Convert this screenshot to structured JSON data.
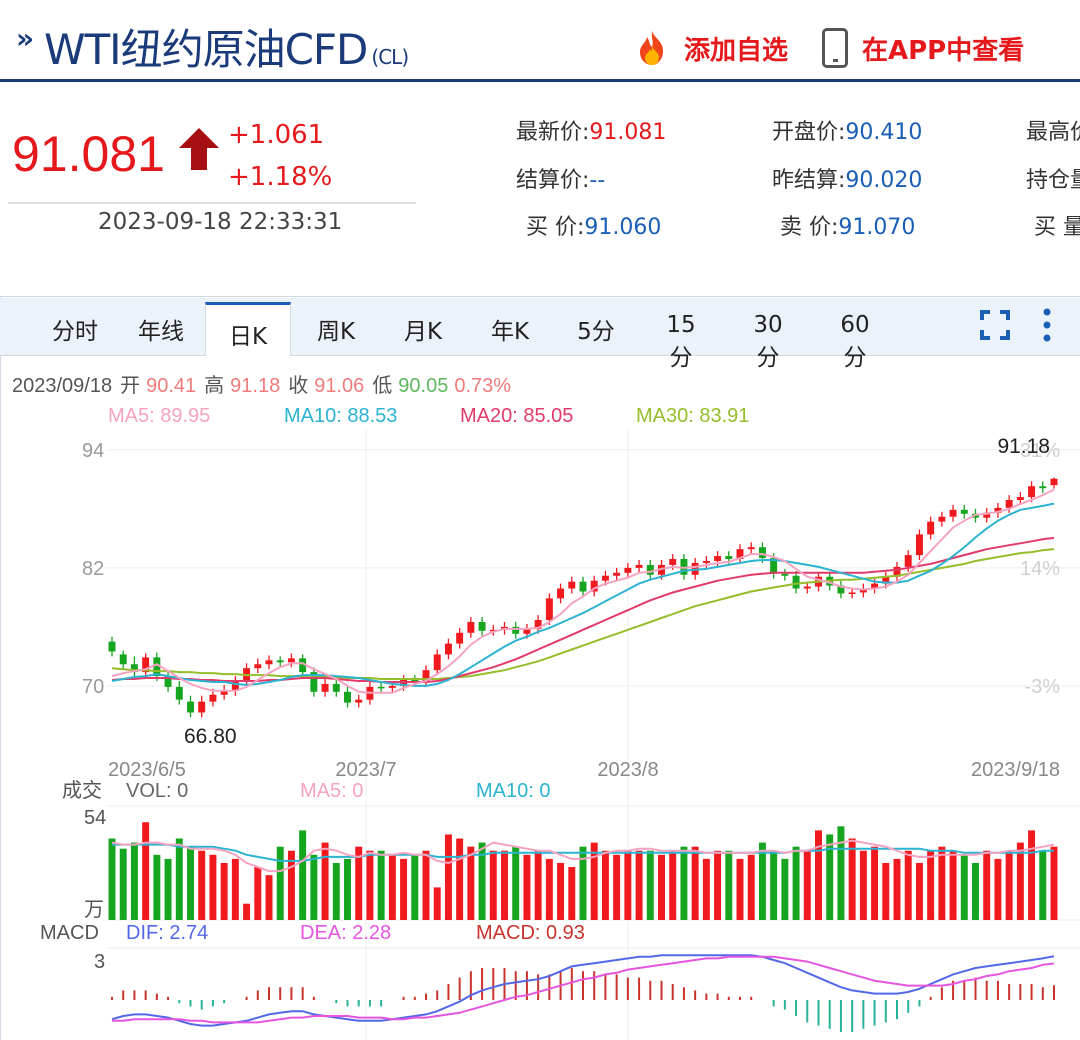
{
  "header": {
    "chevron": "»",
    "title": "WTI纽约原油CFD",
    "title_sub": "(CL)",
    "add_fav_label": "添加自选",
    "app_label": "在APP中查看"
  },
  "price": {
    "last": "91.081",
    "change": "+1.061",
    "change_pct": "+1.18%",
    "time": "2023-09-18 22:33:31"
  },
  "quote": {
    "last_label": "最新价:",
    "last_value": "91.081",
    "open_label": "开盘价:",
    "open_value": "90.410",
    "high_label": "最高价",
    "settle_label": "结算价:",
    "settle_value": "--",
    "prev_settle_label": "昨结算:",
    "prev_settle_value": "90.020",
    "oi_label": "持仓量",
    "bid_label": "买 价:",
    "bid_value": "91.060",
    "ask_label": "卖 价:",
    "ask_value": "91.070",
    "bid_vol_label": "买 量"
  },
  "tabs": [
    "分时",
    "年线",
    "日K",
    "周K",
    "月K",
    "年K",
    "5分",
    "15分",
    "30分",
    "60分"
  ],
  "active_tab": "日K",
  "colors": {
    "up": "#f0191e",
    "down": "#15a51f",
    "ma5": "#f5a3c0",
    "ma10": "#2bb3d1",
    "ma20": "#e23b6b",
    "ma30": "#94be2a",
    "dif": "#5368e6",
    "dea": "#e555e0",
    "macd_up": "#c9332b",
    "macd_down": "#26b39a"
  },
  "chart_data": {
    "type": "candlestick",
    "info_line": {
      "date": "2023/09/18",
      "open_label": "开",
      "open": "90.41",
      "high_label": "高",
      "high": "91.18",
      "close_label": "收",
      "close": "91.06",
      "low_label": "低",
      "low": "90.05",
      "pct": "0.73%"
    },
    "ma_legend": {
      "ma5": "MA5: 89.95",
      "ma10": "MA10: 88.53",
      "ma20": "MA20: 85.05",
      "ma30": "MA30: 83.91"
    },
    "y_ticks": [
      "94",
      "82",
      "70"
    ],
    "y_ticks_right": [
      "31%",
      "14%",
      "-3%"
    ],
    "ylim": [
      64.5,
      95
    ],
    "x_labels": [
      "2023/6/5",
      "2023/7",
      "2023/8",
      "2023/9/18"
    ],
    "max_label": "91.18",
    "min_label": "66.80",
    "closes": [
      73.5,
      72.2,
      71.4,
      72.9,
      71.0,
      69.9,
      68.6,
      67.3,
      68.4,
      69.1,
      69.5,
      70.5,
      71.8,
      72.2,
      72.6,
      72.4,
      72.8,
      71.4,
      69.4,
      70.2,
      69.4,
      68.3,
      68.6,
      69.9,
      69.8,
      70.0,
      70.6,
      70.5,
      71.6,
      73.2,
      74.3,
      75.4,
      76.5,
      75.6,
      75.7,
      76.0,
      75.3,
      75.8,
      76.7,
      78.9,
      79.9,
      80.6,
      79.6,
      80.7,
      81.2,
      81.5,
      82.0,
      82.3,
      81.3,
      82.3,
      82.9,
      81.3,
      82.5,
      82.7,
      83.2,
      82.9,
      83.9,
      84.1,
      83.0,
      81.4,
      81.2,
      79.9,
      80.1,
      81.1,
      80.2,
      79.4,
      79.5,
      79.9,
      80.4,
      81.1,
      82.1,
      83.3,
      85.4,
      86.7,
      87.2,
      87.9,
      87.5,
      87.1,
      87.6,
      88.1,
      88.9,
      89.2,
      90.3,
      90.1,
      91.06
    ],
    "opens": [
      74.5,
      73.2,
      72.2,
      71.4,
      72.9,
      71.0,
      69.9,
      68.4,
      67.3,
      68.4,
      69.1,
      69.5,
      70.5,
      71.8,
      72.2,
      72.6,
      72.4,
      72.8,
      71.4,
      69.4,
      70.2,
      69.4,
      68.3,
      68.6,
      69.9,
      69.8,
      70.0,
      70.6,
      70.5,
      71.6,
      73.2,
      74.3,
      75.4,
      76.5,
      75.6,
      75.7,
      76.0,
      75.3,
      75.8,
      76.7,
      78.9,
      79.9,
      80.6,
      79.6,
      80.7,
      81.2,
      81.5,
      82.0,
      82.3,
      81.3,
      82.3,
      82.9,
      81.3,
      82.5,
      82.7,
      83.2,
      82.9,
      83.9,
      84.1,
      83.0,
      81.4,
      81.2,
      79.9,
      80.1,
      81.1,
      80.2,
      79.4,
      79.5,
      79.9,
      80.4,
      81.1,
      82.1,
      83.3,
      85.4,
      86.7,
      87.2,
      87.9,
      87.5,
      87.1,
      87.6,
      88.1,
      88.9,
      89.2,
      90.3,
      90.41
    ],
    "highs": [
      75.0,
      73.6,
      73.0,
      73.3,
      73.4,
      71.6,
      70.5,
      69.0,
      69.0,
      69.7,
      70.1,
      71.0,
      72.3,
      72.8,
      73.1,
      73.0,
      73.3,
      73.2,
      71.9,
      70.7,
      70.7,
      69.9,
      69.1,
      70.4,
      70.4,
      70.4,
      71.1,
      71.1,
      72.1,
      73.7,
      74.8,
      75.9,
      77.0,
      77.0,
      76.2,
      76.5,
      76.5,
      76.3,
      77.2,
      79.4,
      80.4,
      81.1,
      81.1,
      81.2,
      81.7,
      82.0,
      82.5,
      82.8,
      82.8,
      82.8,
      83.4,
      83.4,
      83.0,
      83.2,
      83.7,
      83.7,
      84.4,
      84.6,
      84.6,
      83.5,
      81.9,
      81.7,
      80.6,
      81.6,
      81.6,
      80.7,
      80.0,
      80.4,
      80.9,
      81.6,
      82.6,
      83.8,
      85.9,
      87.2,
      87.7,
      88.4,
      88.4,
      88.0,
      88.1,
      88.6,
      89.4,
      89.7,
      90.8,
      90.8,
      91.18
    ],
    "lows": [
      73.0,
      71.7,
      70.9,
      70.9,
      70.5,
      69.4,
      68.1,
      66.8,
      66.8,
      67.9,
      68.6,
      69.0,
      70.0,
      71.3,
      71.7,
      71.9,
      71.9,
      70.9,
      68.9,
      68.9,
      68.9,
      67.8,
      67.8,
      68.1,
      69.3,
      69.3,
      69.5,
      70.0,
      70.0,
      71.1,
      72.7,
      73.8,
      74.9,
      75.1,
      75.1,
      75.2,
      74.8,
      74.8,
      75.3,
      76.2,
      78.4,
      79.4,
      79.1,
      79.1,
      80.2,
      80.7,
      81.0,
      81.5,
      80.8,
      80.8,
      81.8,
      80.8,
      80.8,
      82.0,
      82.2,
      82.4,
      82.4,
      83.4,
      82.5,
      80.9,
      80.7,
      79.4,
      79.4,
      79.6,
      79.7,
      78.9,
      78.9,
      79.0,
      79.4,
      79.9,
      80.6,
      81.6,
      82.8,
      84.9,
      86.2,
      86.7,
      87.0,
      86.6,
      86.6,
      87.1,
      87.6,
      88.4,
      88.7,
      89.6,
      90.05
    ],
    "ma5": [
      71.0,
      71.3,
      71.5,
      71.7,
      72.2,
      71.5,
      70.8,
      70.2,
      69.8,
      69.5,
      69.5,
      69.5,
      69.9,
      70.6,
      71.3,
      71.9,
      72.3,
      72.3,
      71.7,
      71.2,
      70.7,
      70.0,
      69.4,
      69.3,
      69.3,
      69.3,
      69.8,
      70.2,
      70.5,
      71.2,
      72.0,
      73.0,
      74.2,
      75.0,
      75.5,
      75.8,
      75.8,
      75.8,
      75.9,
      76.5,
      77.3,
      78.4,
      79.1,
      79.9,
      80.4,
      80.7,
      81.0,
      81.5,
      81.6,
      81.9,
      82.1,
      82.0,
      82.1,
      82.3,
      82.5,
      82.6,
      83.0,
      83.4,
      83.4,
      83.1,
      82.7,
      81.9,
      81.1,
      80.8,
      80.5,
      80.1,
      79.9,
      79.8,
      79.9,
      80.1,
      80.6,
      81.3,
      82.5,
      83.7,
      84.9,
      86.1,
      86.8,
      87.4,
      87.5,
      87.7,
      88.0,
      88.5,
      88.9,
      89.4,
      89.95
    ],
    "ma10": [
      70.5,
      70.7,
      70.9,
      71.0,
      71.2,
      71.0,
      70.8,
      70.6,
      70.5,
      70.4,
      70.4,
      70.2,
      70.1,
      70.2,
      70.4,
      70.6,
      70.9,
      71.1,
      71.1,
      71.1,
      71.0,
      70.9,
      70.8,
      70.6,
      70.4,
      70.2,
      70.1,
      70.0,
      70.0,
      70.2,
      70.6,
      71.2,
      71.9,
      72.6,
      73.3,
      74.0,
      74.6,
      75.0,
      75.5,
      75.9,
      76.4,
      76.9,
      77.4,
      78.0,
      78.6,
      79.2,
      79.8,
      80.4,
      80.8,
      81.1,
      81.4,
      81.7,
      81.8,
      81.9,
      82.1,
      82.3,
      82.5,
      82.7,
      82.8,
      82.8,
      82.7,
      82.5,
      82.3,
      82.1,
      81.8,
      81.5,
      81.2,
      80.9,
      80.6,
      80.5,
      80.5,
      80.7,
      81.2,
      81.7,
      82.4,
      83.2,
      84.1,
      85.1,
      86.0,
      86.8,
      87.4,
      87.9,
      88.1,
      88.3,
      88.53
    ],
    "ma20": [
      70.6,
      70.7,
      70.7,
      70.8,
      70.8,
      70.8,
      70.7,
      70.7,
      70.6,
      70.6,
      70.5,
      70.5,
      70.5,
      70.5,
      70.6,
      70.6,
      70.7,
      70.8,
      70.8,
      70.8,
      70.7,
      70.6,
      70.5,
      70.5,
      70.4,
      70.4,
      70.4,
      70.4,
      70.4,
      70.5,
      70.7,
      71.0,
      71.3,
      71.6,
      71.9,
      72.3,
      72.7,
      73.2,
      73.7,
      74.2,
      74.7,
      75.2,
      75.7,
      76.2,
      76.7,
      77.2,
      77.7,
      78.2,
      78.7,
      79.1,
      79.5,
      79.8,
      80.1,
      80.4,
      80.7,
      80.9,
      81.1,
      81.3,
      81.4,
      81.5,
      81.5,
      81.5,
      81.5,
      81.5,
      81.5,
      81.5,
      81.5,
      81.5,
      81.6,
      81.7,
      81.8,
      82.0,
      82.2,
      82.4,
      82.7,
      83.0,
      83.3,
      83.6,
      83.9,
      84.1,
      84.3,
      84.5,
      84.7,
      84.9,
      85.05
    ],
    "ma30": [
      71.8,
      71.7,
      71.6,
      71.6,
      71.5,
      71.5,
      71.4,
      71.4,
      71.3,
      71.3,
      71.2,
      71.2,
      71.1,
      71.1,
      71.1,
      71.0,
      71.0,
      71.0,
      70.9,
      70.9,
      70.9,
      70.8,
      70.8,
      70.8,
      70.7,
      70.7,
      70.7,
      70.7,
      70.7,
      70.7,
      70.8,
      70.9,
      71.0,
      71.2,
      71.4,
      71.6,
      71.9,
      72.2,
      72.5,
      72.9,
      73.3,
      73.7,
      74.1,
      74.5,
      74.9,
      75.3,
      75.7,
      76.1,
      76.5,
      76.9,
      77.3,
      77.7,
      78.1,
      78.4,
      78.7,
      79.0,
      79.3,
      79.6,
      79.8,
      80.0,
      80.2,
      80.4,
      80.5,
      80.6,
      80.7,
      80.8,
      80.8,
      80.9,
      81.0,
      81.1,
      81.2,
      81.4,
      81.6,
      81.8,
      82.0,
      82.2,
      82.4,
      82.7,
      82.9,
      83.1,
      83.3,
      83.5,
      83.6,
      83.8,
      83.91
    ],
    "volume_panel": {
      "title": "成交",
      "vol_label": "VOL: 0",
      "ma5_label": "MA5: 0",
      "ma10_label": "MA10: 0",
      "y_top": "54",
      "y_unit": "万",
      "volumes": [
        40,
        35,
        38,
        48,
        32,
        30,
        40,
        36,
        34,
        32,
        28,
        30,
        8,
        26,
        22,
        36,
        34,
        44,
        32,
        38,
        28,
        30,
        36,
        34,
        34,
        32,
        30,
        32,
        34,
        16,
        42,
        40,
        36,
        38,
        34,
        34,
        36,
        32,
        34,
        30,
        28,
        26,
        36,
        38,
        34,
        32,
        34,
        34,
        34,
        32,
        34,
        36,
        36,
        30,
        34,
        34,
        30,
        32,
        38,
        34,
        30,
        36,
        34,
        44,
        42,
        46,
        40,
        34,
        36,
        28,
        30,
        34,
        28,
        34,
        36,
        34,
        32,
        28,
        34,
        30,
        34,
        38,
        44,
        34,
        36
      ],
      "vol_ma5": [
        38,
        37,
        37,
        38,
        38,
        37,
        37,
        35,
        35,
        35,
        34,
        32,
        28,
        26,
        24,
        24,
        26,
        29,
        34,
        35,
        34,
        32,
        31,
        33,
        32,
        32,
        33,
        32,
        32,
        29,
        28,
        30,
        32,
        35,
        38,
        37,
        36,
        35,
        34,
        34,
        32,
        30,
        30,
        31,
        33,
        34,
        34,
        35,
        35,
        34,
        34,
        34,
        34,
        33,
        33,
        33,
        33,
        33,
        34,
        34,
        33,
        34,
        34,
        36,
        37,
        38,
        39,
        38,
        37,
        36,
        34,
        32,
        31,
        31,
        32,
        32,
        32,
        32,
        33,
        33,
        34,
        34,
        35,
        36,
        37
      ],
      "vol_ma10": [
        37,
        37,
        37,
        37,
        37,
        37,
        36,
        36,
        36,
        36,
        35,
        34,
        32,
        31,
        30,
        29,
        29,
        29,
        30,
        31,
        31,
        31,
        31,
        32,
        32,
        32,
        32,
        32,
        32,
        31,
        31,
        31,
        32,
        32,
        33,
        33,
        33,
        33,
        33,
        33,
        33,
        33,
        33,
        33,
        33,
        33,
        33,
        33,
        33,
        33,
        33,
        33,
        33,
        33,
        33,
        33,
        33,
        33,
        33,
        33,
        33,
        34,
        34,
        34,
        35,
        35,
        35,
        35,
        35,
        35,
        35,
        35,
        35,
        34,
        34,
        34,
        33,
        33,
        33,
        33,
        33,
        33,
        33,
        34,
        34
      ]
    },
    "macd_panel": {
      "title": "MACD",
      "dif_label": "DIF: 2.74",
      "dea_label": "DEA: 2.28",
      "macd_label": "MACD: 0.93",
      "y_top": "3",
      "dif": [
        -1.2,
        -1.0,
        -0.9,
        -0.9,
        -1.0,
        -1.1,
        -1.3,
        -1.5,
        -1.6,
        -1.6,
        -1.5,
        -1.4,
        -1.3,
        -1.1,
        -0.9,
        -0.8,
        -0.7,
        -0.7,
        -0.9,
        -1.0,
        -1.1,
        -1.2,
        -1.3,
        -1.3,
        -1.3,
        -1.2,
        -1.1,
        -1.0,
        -0.9,
        -0.7,
        -0.4,
        -0.1,
        0.3,
        0.6,
        0.8,
        1.0,
        1.1,
        1.2,
        1.3,
        1.5,
        1.8,
        2.1,
        2.2,
        2.3,
        2.4,
        2.5,
        2.6,
        2.7,
        2.7,
        2.8,
        2.8,
        2.8,
        2.8,
        2.8,
        2.8,
        2.8,
        2.8,
        2.8,
        2.7,
        2.5,
        2.3,
        2.0,
        1.7,
        1.4,
        1.1,
        0.8,
        0.6,
        0.5,
        0.4,
        0.4,
        0.4,
        0.5,
        0.7,
        1.0,
        1.3,
        1.6,
        1.8,
        2.0,
        2.1,
        2.2,
        2.3,
        2.4,
        2.5,
        2.6,
        2.74
      ],
      "dea": [
        -1.3,
        -1.3,
        -1.2,
        -1.2,
        -1.2,
        -1.2,
        -1.2,
        -1.3,
        -1.3,
        -1.4,
        -1.4,
        -1.4,
        -1.4,
        -1.4,
        -1.3,
        -1.2,
        -1.1,
        -1.1,
        -1.0,
        -1.0,
        -1.0,
        -1.0,
        -1.1,
        -1.1,
        -1.1,
        -1.2,
        -1.2,
        -1.1,
        -1.1,
        -1.0,
        -0.9,
        -0.8,
        -0.6,
        -0.4,
        -0.2,
        0.0,
        0.2,
        0.3,
        0.5,
        0.7,
        0.9,
        1.1,
        1.3,
        1.4,
        1.6,
        1.7,
        1.9,
        2.0,
        2.1,
        2.2,
        2.3,
        2.4,
        2.5,
        2.6,
        2.6,
        2.7,
        2.7,
        2.7,
        2.7,
        2.7,
        2.6,
        2.5,
        2.4,
        2.2,
        2.0,
        1.8,
        1.6,
        1.4,
        1.2,
        1.1,
        1.0,
        0.9,
        0.9,
        0.9,
        0.9,
        1.0,
        1.2,
        1.3,
        1.5,
        1.6,
        1.8,
        1.9,
        2.0,
        2.2,
        2.28
      ]
    }
  }
}
